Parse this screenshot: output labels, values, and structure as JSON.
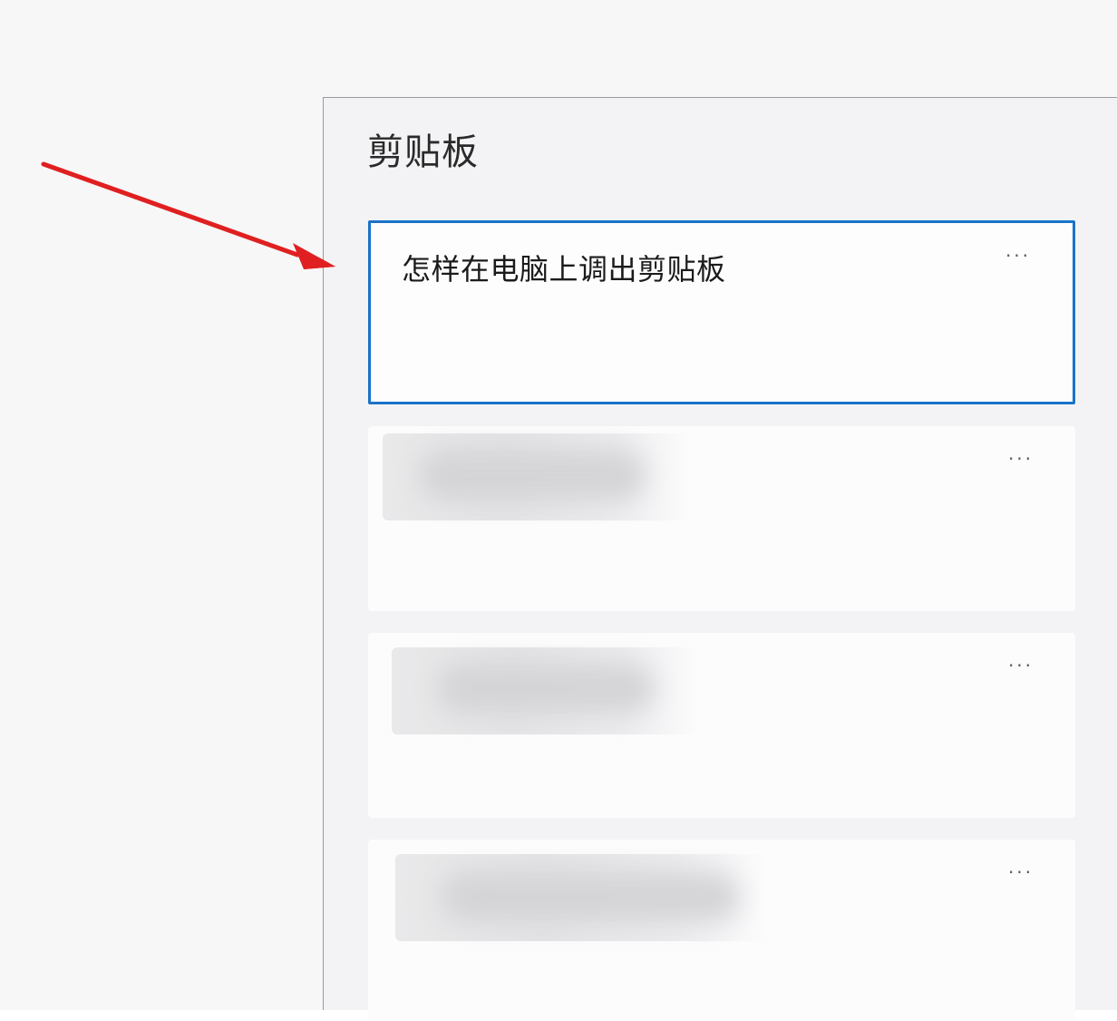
{
  "clipboard": {
    "title": "剪贴板",
    "items": [
      {
        "text": "怎样在电脑上调出剪贴板",
        "more_label": "···",
        "selected": true
      },
      {
        "text": "",
        "more_label": "···",
        "selected": false
      },
      {
        "text": "",
        "more_label": "···",
        "selected": false
      },
      {
        "text": "",
        "more_label": "···",
        "selected": false
      }
    ]
  },
  "colors": {
    "selection_border": "#1a73c9",
    "annotation_arrow": "#e02020"
  },
  "icons": {
    "annotation": "red-arrow-icon",
    "more": "more-options-icon"
  }
}
